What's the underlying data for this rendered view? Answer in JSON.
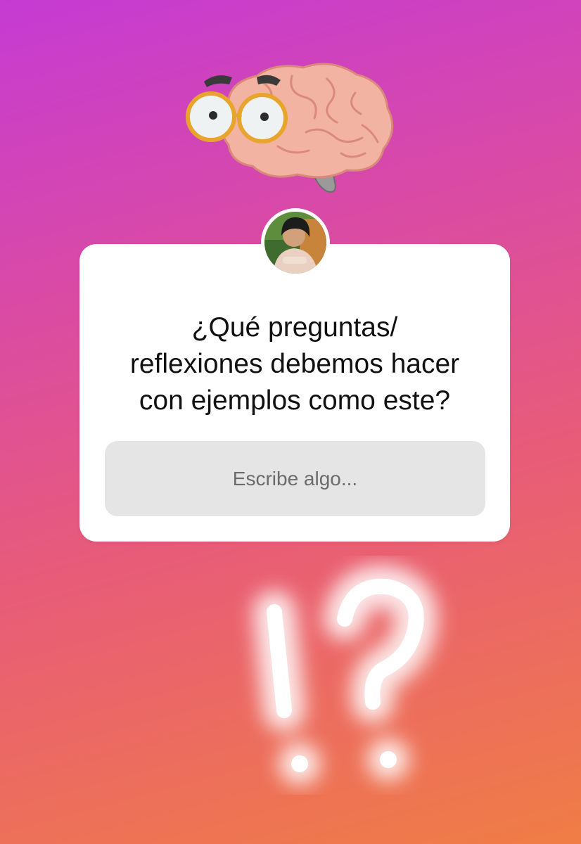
{
  "stickers": {
    "brain": "brain-with-glasses-icon",
    "punctuation": "exclamation-question-icon"
  },
  "question_box": {
    "avatar": "profile-photo",
    "question": "¿Qué preguntas/\nreflexiones debemos hacer\ncon ejemplos como este?",
    "answer_placeholder": "Escribe algo..."
  },
  "colors": {
    "gradient_top": "#c53bd3",
    "gradient_bottom": "#f07d45",
    "card": "#ffffff",
    "input": "#e5e5e5"
  }
}
